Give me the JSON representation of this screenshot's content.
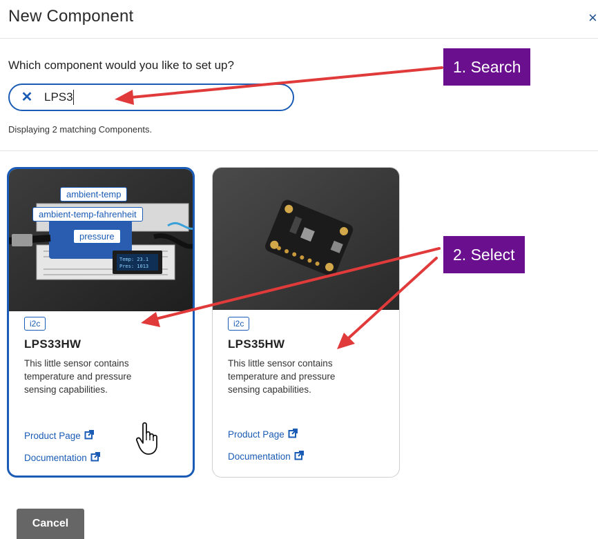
{
  "dialog": {
    "title": "New Component",
    "close_label": "×"
  },
  "search": {
    "question": "Which component would you like to set up?",
    "value": "LPS3",
    "clear_label": "✕",
    "match_count_text": "Displaying 2 matching Components."
  },
  "cards": [
    {
      "tags": [
        "ambient-temp",
        "ambient-temp-fahrenheit",
        "pressure"
      ],
      "protocol": "i2c",
      "title": "LPS33HW",
      "description": "This little sensor contains temperature and pressure sensing capabilities.",
      "product_link": "Product Page",
      "docs_link": "Documentation",
      "selected": true
    },
    {
      "tags": [],
      "protocol": "i2c",
      "title": "LPS35HW",
      "description": "This little sensor contains temperature and pressure sensing capabilities.",
      "product_link": "Product Page",
      "docs_link": "Documentation",
      "selected": false
    }
  ],
  "footer": {
    "cancel_label": "Cancel"
  },
  "annotations": {
    "step1": "1. Search",
    "step2": "2. Select"
  },
  "colors": {
    "accent": "#1a5bb5",
    "callout": "#6a0f8e",
    "arrow": "#e03a3a",
    "cancel_bg": "#666666"
  },
  "icons": {
    "close": "close-icon",
    "clear": "clear-search-icon",
    "external_link": "external-link-icon",
    "cursor": "hand-pointer-icon"
  }
}
